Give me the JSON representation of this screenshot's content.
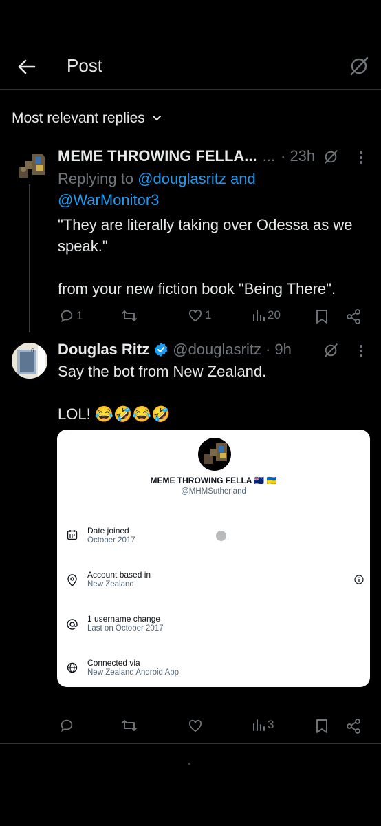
{
  "header": {
    "title": "Post"
  },
  "sort": {
    "label": "Most relevant replies"
  },
  "reply1": {
    "name": "MEME THROWING FELLA...",
    "dots": "...",
    "time": "· 23h",
    "replying_prefix": "Replying to",
    "replying_to_1": "@douglasritz and",
    "replying_to_2": "@WarMonitor3",
    "text": "\"They are literally taking over Odessa as we speak.\"\n\nfrom your new fiction book \"Being There\".",
    "replies": "1",
    "likes": "1",
    "views": "20"
  },
  "reply2": {
    "name": "Douglas Ritz",
    "handle": "@douglasritz",
    "time": "· 9h",
    "text": "Say the bot from New Zealand.\n\nLOL! 😂🤣😂🤣",
    "views": "3",
    "card": {
      "name": "MEME THROWING FELLA 🇳🇿 🇺🇦",
      "handle": "@MHMSutherland",
      "rows": [
        {
          "label": "Date joined",
          "value": "October 2017"
        },
        {
          "label": "Account based in",
          "value": "New Zealand"
        },
        {
          "label": "1 username change",
          "value": "Last on October 2017"
        },
        {
          "label": "Connected via",
          "value": "New Zealand Android App"
        }
      ]
    }
  },
  "colors": {
    "background": "#000000",
    "text": "#e7e9ea",
    "muted": "#71767b",
    "link": "#1d9bf0",
    "verified": "#1d9bf0"
  }
}
